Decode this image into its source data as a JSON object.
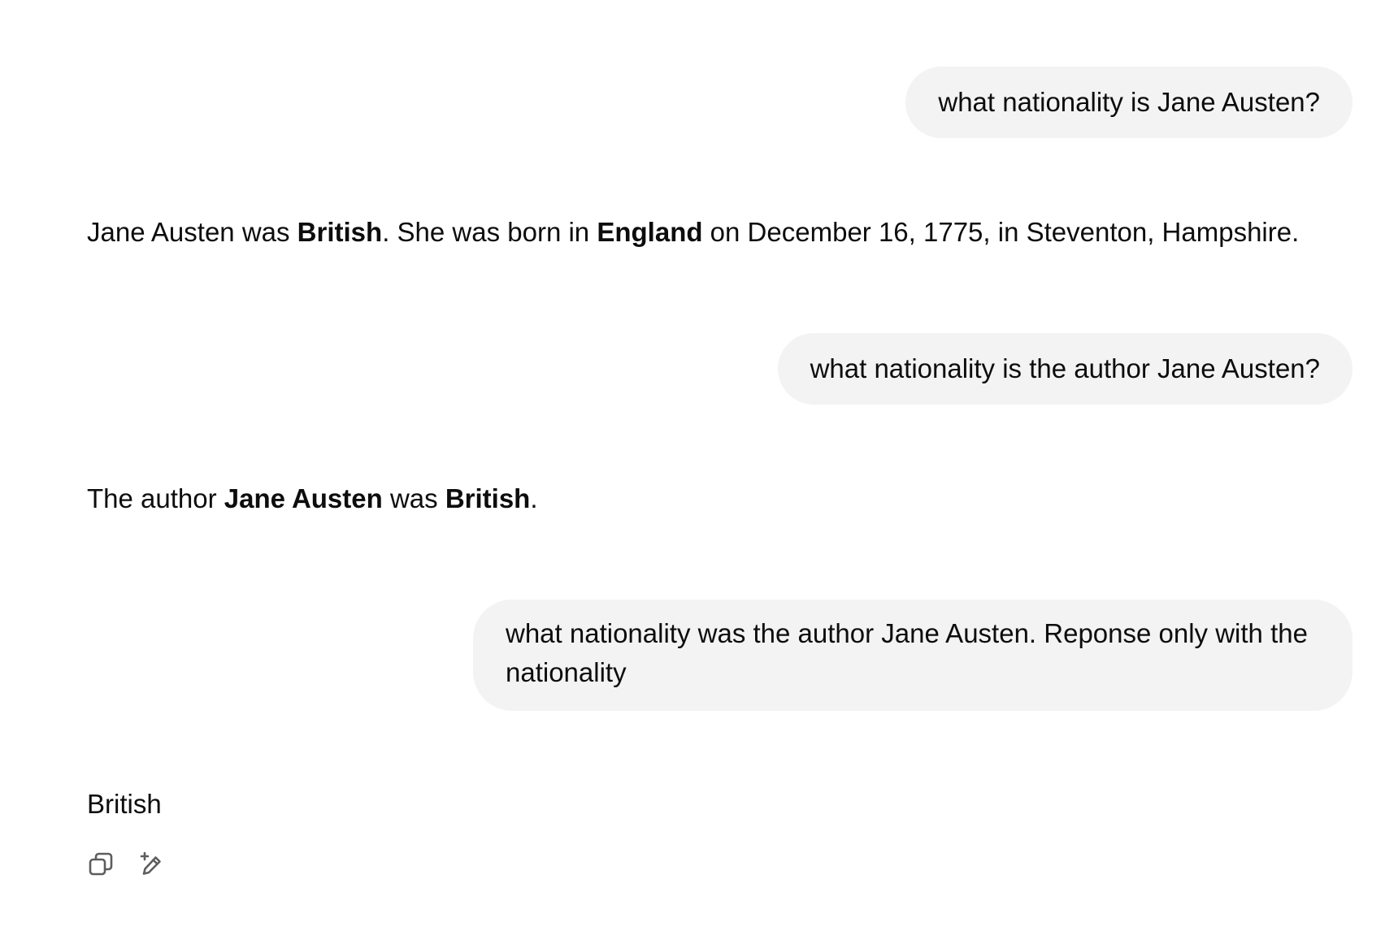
{
  "conversation": {
    "turns": [
      {
        "role": "user",
        "text": "what nationality is Jane Austen?"
      },
      {
        "role": "assistant",
        "segments": [
          {
            "text": "Jane Austen was ",
            "bold": false
          },
          {
            "text": "British",
            "bold": true
          },
          {
            "text": ". She was born in ",
            "bold": false
          },
          {
            "text": "England",
            "bold": true
          },
          {
            "text": " on December 16, 1775, in Steventon, Hampshire.",
            "bold": false
          }
        ]
      },
      {
        "role": "user",
        "text": "what nationality is the author Jane Austen?"
      },
      {
        "role": "assistant",
        "segments": [
          {
            "text": "The author ",
            "bold": false
          },
          {
            "text": "Jane Austen",
            "bold": true
          },
          {
            "text": " was ",
            "bold": false
          },
          {
            "text": "British",
            "bold": true
          },
          {
            "text": ".",
            "bold": false
          }
        ]
      },
      {
        "role": "user",
        "text": "what nationality was the author Jane Austen. Reponse only with the nationality"
      },
      {
        "role": "assistant",
        "segments": [
          {
            "text": "British",
            "bold": false
          }
        ]
      }
    ]
  },
  "actions": {
    "copy_icon": "copy-icon",
    "edit_icon": "edit-sparkle-icon"
  },
  "colors": {
    "user_bubble_bg": "#f3f3f3",
    "text": "#0d0d0d",
    "icon": "#5d5d5d"
  }
}
